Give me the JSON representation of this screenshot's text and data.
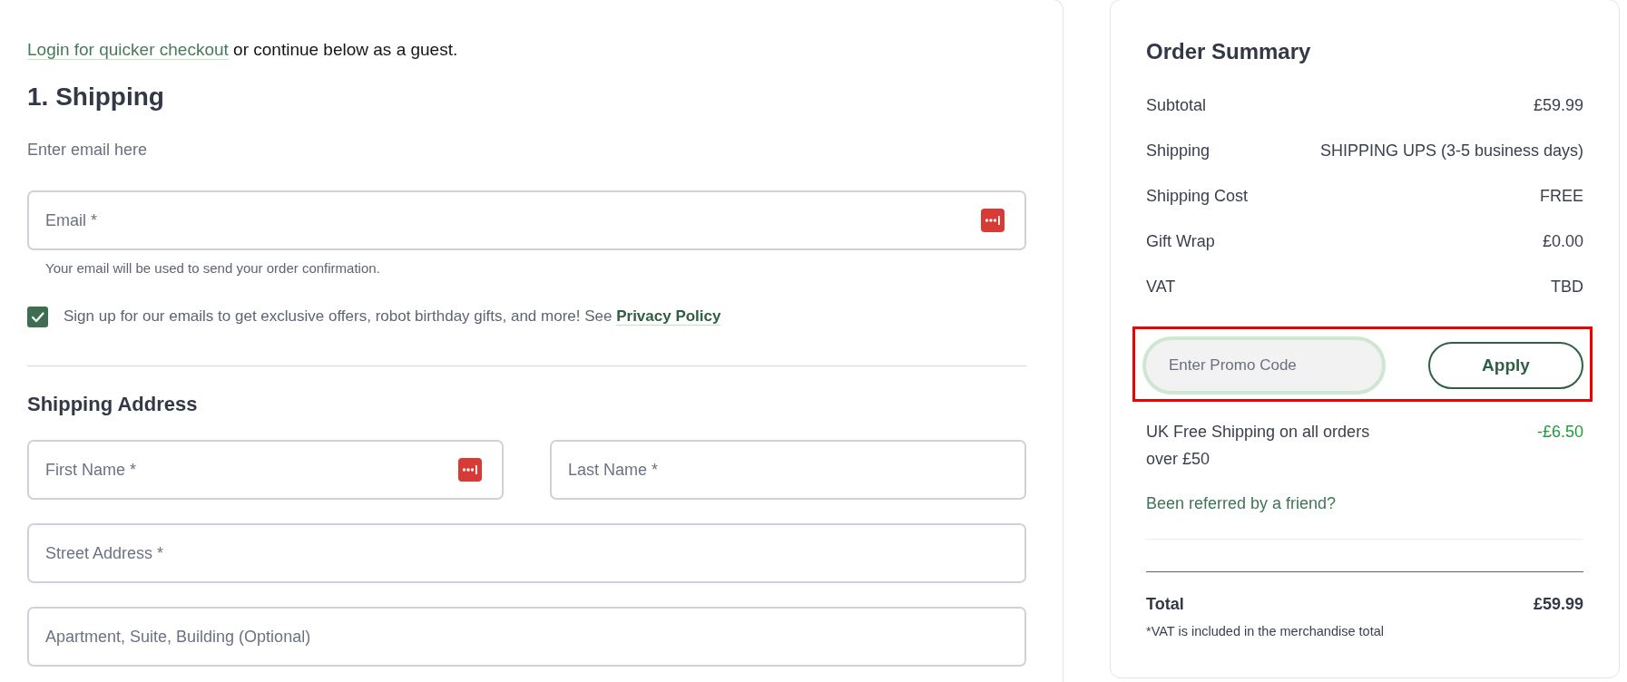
{
  "login_prompt": {
    "link": "Login for quicker checkout",
    "text": "or continue below as a guest."
  },
  "shipping": {
    "title": "1. Shipping",
    "email_prompt": "Enter email here",
    "email_field": {
      "placeholder": "Email *",
      "autofill_icon": true
    },
    "email_hint": "Your email will be used to send your order confirmation.",
    "newsletter": {
      "checked": true,
      "text": "Sign up for our emails to get exclusive offers, robot birthday gifts, and more! See",
      "link": "Privacy Policy"
    },
    "address": {
      "title": "Shipping Address",
      "rows": [
        {
          "fields": [
            {
              "placeholder": "First Name *",
              "autofill_icon": true
            },
            {
              "placeholder": "Last Name *",
              "autofill_icon": false
            }
          ]
        },
        {
          "fields": [
            {
              "placeholder": "Street Address *",
              "autofill_icon": false
            }
          ]
        },
        {
          "fields": [
            {
              "placeholder": "Apartment, Suite, Building (Optional)",
              "autofill_icon": false
            }
          ]
        }
      ]
    }
  },
  "order_summary": {
    "title": "Order Summary",
    "lines": [
      {
        "label": "Subtotal",
        "value": "£59.99"
      },
      {
        "label": "Shipping",
        "value": "SHIPPING UPS (3-5 business days)"
      },
      {
        "label": "Shipping Cost",
        "value": "FREE"
      },
      {
        "label": "Gift Wrap",
        "value": "£0.00"
      },
      {
        "label": "VAT",
        "value": "TBD"
      }
    ],
    "promo": {
      "highlighted": true,
      "placeholder": "Enter Promo Code",
      "focused": true,
      "button": "Apply"
    },
    "discounts": [
      {
        "label": "UK Free Shipping on all orders over £50",
        "amount": "-£6.50"
      }
    ],
    "referral_link": "Been referred by a friend?",
    "total": {
      "label": "Total",
      "value": "£59.99"
    },
    "note": "*VAT is included in the merchandise total"
  }
}
